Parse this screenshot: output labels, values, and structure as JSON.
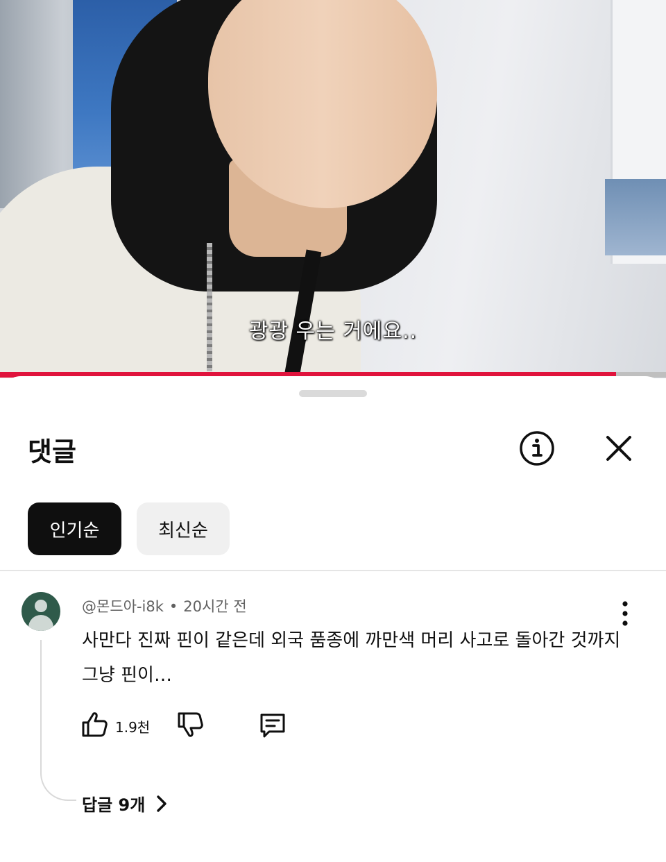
{
  "video": {
    "subtitle": "광광 우는 거에요..",
    "progress_fraction": 0.925,
    "progress_color": "#e0133c"
  },
  "sheet": {
    "title": "댓글",
    "info_icon": "info-circle-icon",
    "close_icon": "close-icon",
    "sort_chips": [
      {
        "label": "인기순",
        "selected": true
      },
      {
        "label": "최신순",
        "selected": false
      }
    ]
  },
  "comment": {
    "author": "@몬드아-i8k",
    "separator": "•",
    "time": "20시간 전",
    "text": "사만다 진짜 핀이 같은데 외국 품종에 까만색 머리 사고로 돌아간 것까지 그냥 핀이…",
    "like_count": "1.9천",
    "icons": {
      "like": "thumbs-up-icon",
      "dislike": "thumbs-down-icon",
      "reply": "reply-comment-icon",
      "more": "more-vertical-icon"
    },
    "replies_label": "답글 9개"
  }
}
